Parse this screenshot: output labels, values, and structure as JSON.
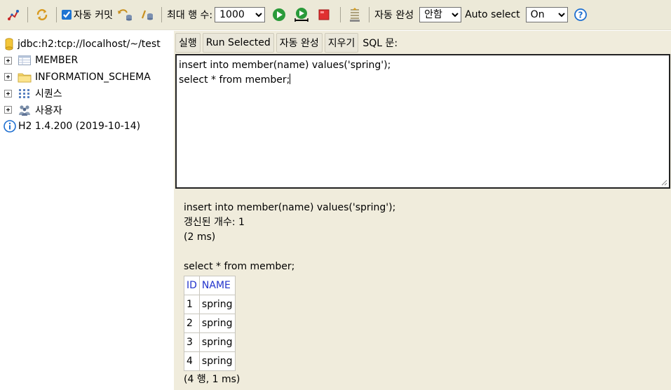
{
  "toolbar": {
    "autocommit_label": "자동 커밋",
    "autocommit_checked": true,
    "max_rows_label": "최대 행 수:",
    "max_rows_value": "1000",
    "autocomplete_label": "자동 완성",
    "autocomplete_value": "안함",
    "auto_select_label": "Auto select",
    "auto_select_value": "On",
    "colors": {
      "run": "#2a9a3a",
      "stop": "#e03030",
      "help": "#1e6fd0"
    }
  },
  "tree": {
    "connection": "jdbc:h2:tcp://localhost/~/test",
    "items": [
      {
        "label": "MEMBER",
        "icon": "table-icon"
      },
      {
        "label": "INFORMATION_SCHEMA",
        "icon": "folder-icon"
      },
      {
        "label": "시퀀스",
        "icon": "sequence-icon"
      },
      {
        "label": "사용자",
        "icon": "users-icon"
      }
    ],
    "version": "H2 1.4.200 (2019-10-14)"
  },
  "buttons": {
    "run": "실행",
    "run_selected": "Run Selected",
    "autocomplete": "자동 완성",
    "clear": "지우기",
    "sql_label": "SQL 문:"
  },
  "editor": {
    "line1": "insert into member(name) values('spring');",
    "line2": "select * from member;"
  },
  "result": {
    "stmt1": "insert into member(name) values('spring');",
    "updated": "갱신된 개수: 1",
    "time1": "(2 ms)",
    "stmt2": "select * from member;",
    "columns": [
      "ID",
      "NAME"
    ],
    "rows": [
      [
        "1",
        "spring"
      ],
      [
        "2",
        "spring"
      ],
      [
        "3",
        "spring"
      ],
      [
        "4",
        "spring"
      ]
    ],
    "summary": "(4 행, 1 ms)"
  }
}
